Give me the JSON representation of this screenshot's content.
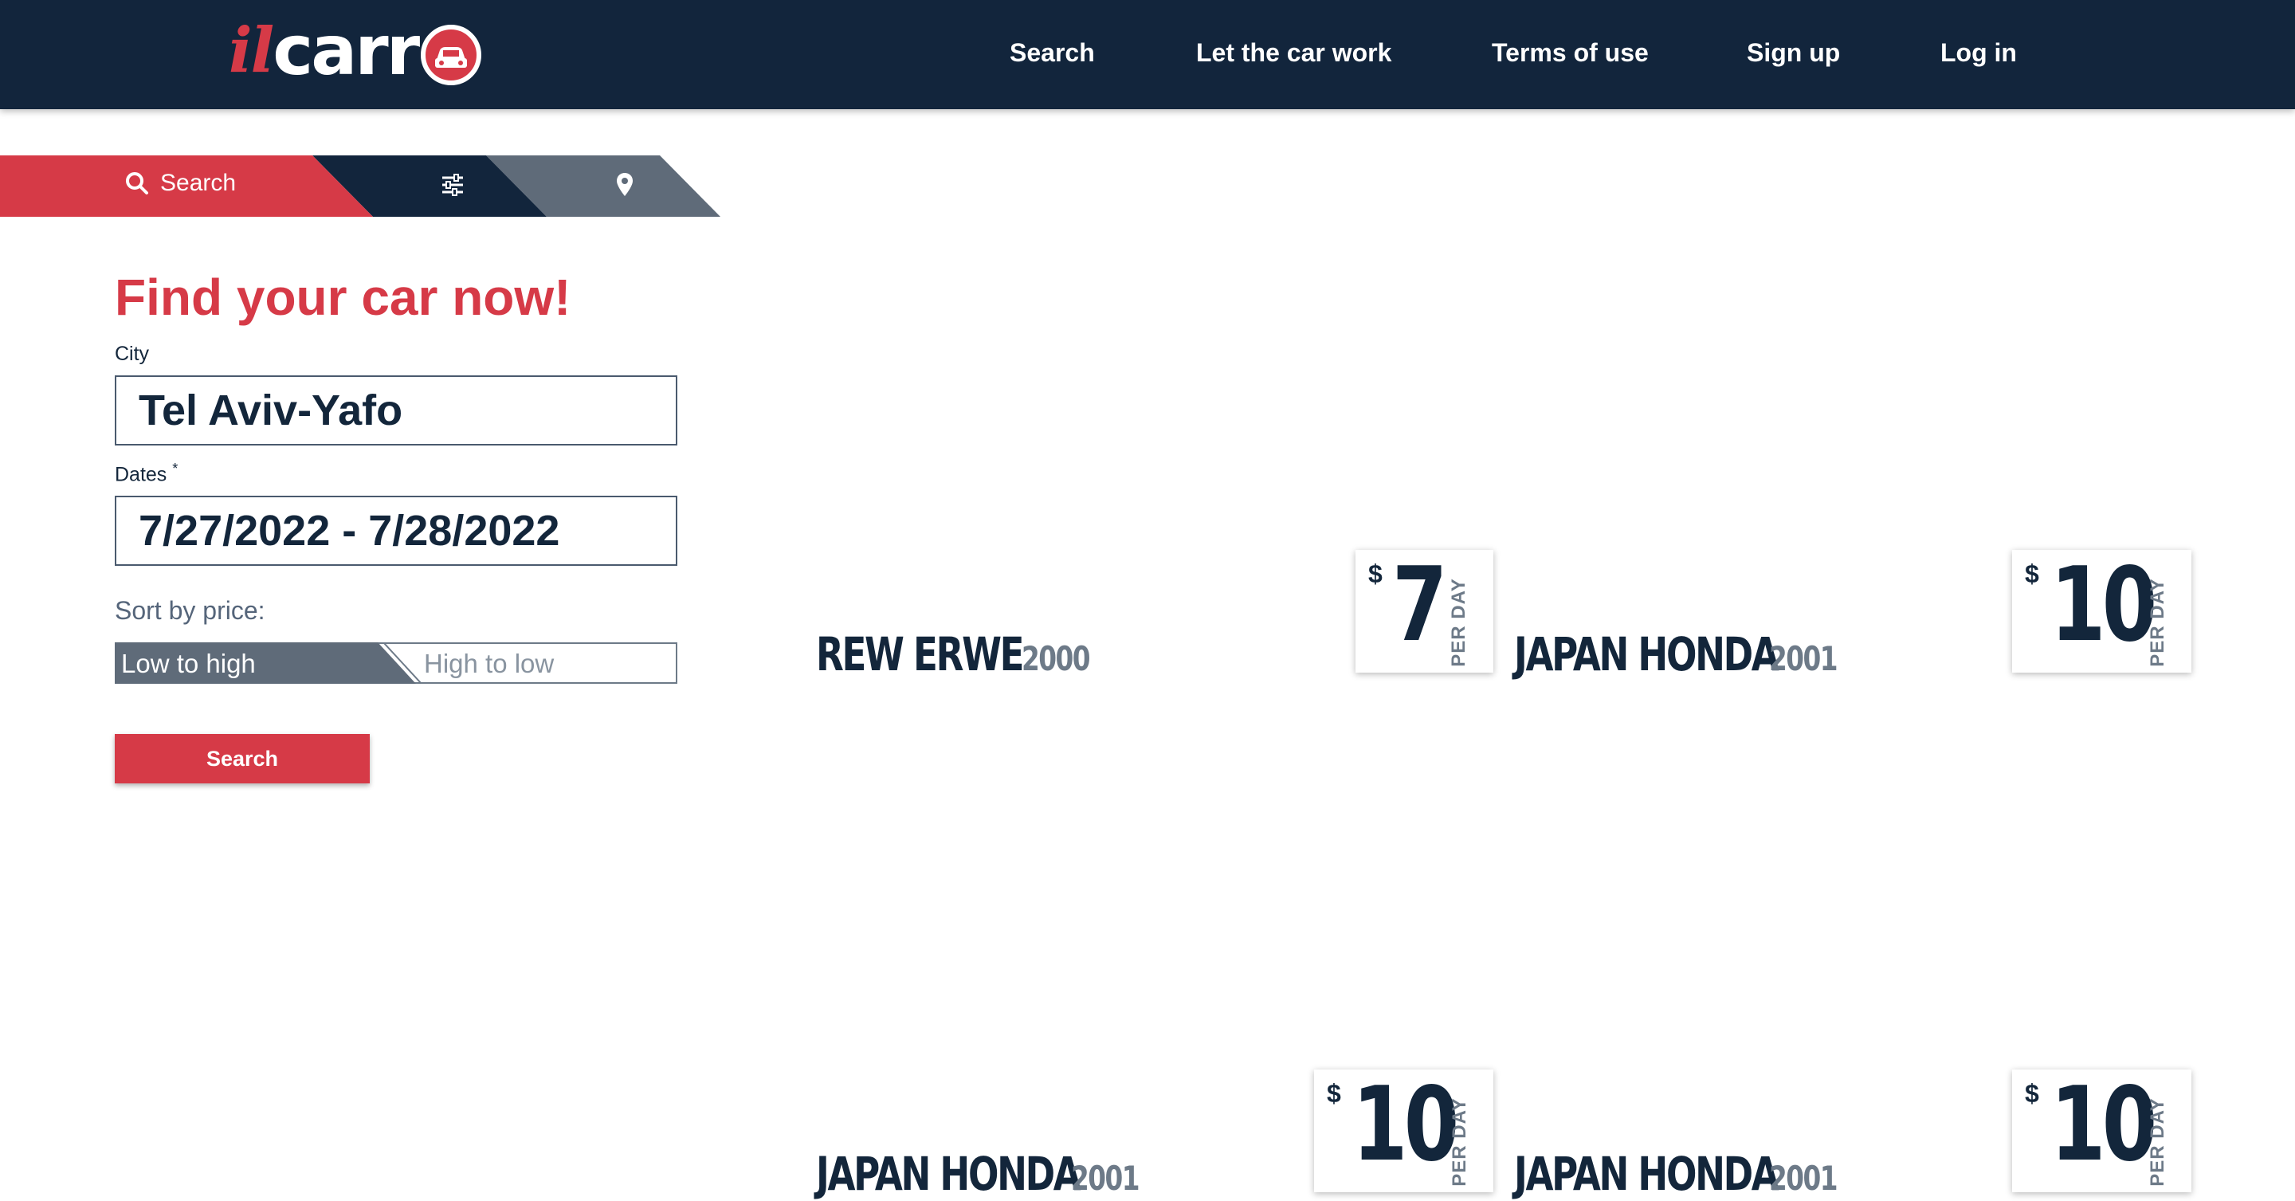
{
  "header": {
    "logo": {
      "prefix": "il",
      "main": "carr"
    },
    "nav": [
      {
        "label": "Search"
      },
      {
        "label": "Let the car work"
      },
      {
        "label": "Terms of use"
      },
      {
        "label": "Sign up"
      },
      {
        "label": "Log in"
      }
    ]
  },
  "tabs": {
    "search_label": "Search",
    "filter_icon": "sliders-icon",
    "map_icon": "map-pin-icon"
  },
  "form": {
    "title": "Find your car now!",
    "city_label": "City",
    "city_value": "Tel Aviv-Yafo",
    "dates_label": "Dates",
    "dates_required_mark": "*",
    "dates_value": "7/27/2022 - 7/28/2022",
    "sort_label": "Sort by price:",
    "sort_options": [
      "Low to high",
      "High to low"
    ],
    "sort_selected": "Low to high",
    "search_button": "Search"
  },
  "results": [
    {
      "name": "REW ERWE",
      "year": "2000",
      "currency": "$",
      "price": "7",
      "unit": "PER DAY"
    },
    {
      "name": "JAPAN HONDA",
      "year": "2001",
      "currency": "$",
      "price": "10",
      "unit": "PER DAY"
    },
    {
      "name": "JAPAN HONDA",
      "year": "2001",
      "currency": "$",
      "price": "10",
      "unit": "PER DAY"
    },
    {
      "name": "JAPAN HONDA",
      "year": "2001",
      "currency": "$",
      "price": "10",
      "unit": "PER DAY"
    }
  ],
  "colors": {
    "navy": "#12253c",
    "red": "#d63a47",
    "slate": "#5f6b79",
    "white": "#ffffff"
  }
}
